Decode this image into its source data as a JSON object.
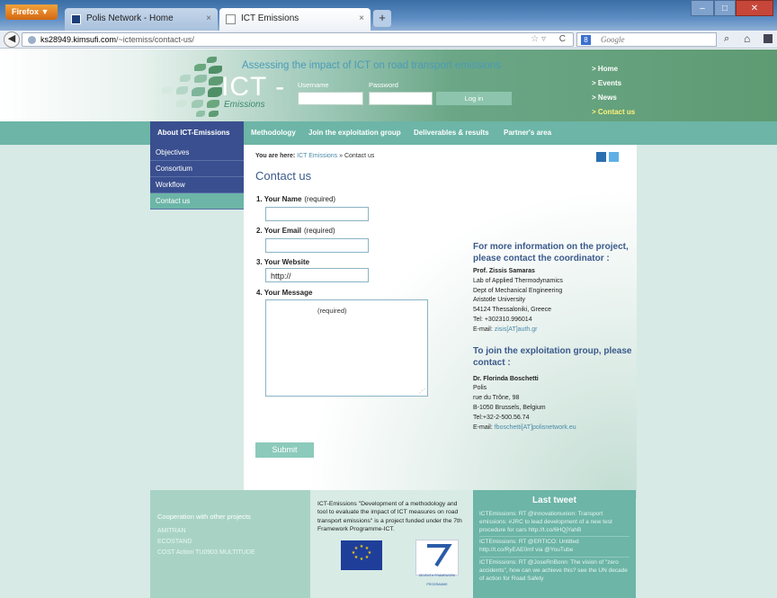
{
  "browser": {
    "menu_button": "Firefox ▼",
    "tabs": [
      {
        "title": "Polis Network - Home"
      },
      {
        "title": "ICT Emissions"
      }
    ],
    "new_tab": "+",
    "url_host": "ks28949.kimsufi.com",
    "url_path": "/~ictemiss/contact-us/",
    "search_placeholder": "Google",
    "search_engine_letter": "8"
  },
  "header": {
    "tagline": "Assessing the impact of ICT on road transport emissions",
    "logo_text": "ICT -",
    "logo_sub": "Emissions",
    "username_label": "Username",
    "password_label": "Password",
    "login_button": "Log in",
    "toplinks": [
      {
        "label": "> Home"
      },
      {
        "label": "> Events"
      },
      {
        "label": "> News"
      },
      {
        "label": "> Contact us"
      }
    ]
  },
  "nav": {
    "items": [
      {
        "label": "About ICT-Emissions"
      },
      {
        "label": "Methodology"
      },
      {
        "label": "Join the exploitation group"
      },
      {
        "label": "Deliverables & results"
      },
      {
        "label": "Partner's area"
      }
    ]
  },
  "sidebar": {
    "items": [
      {
        "label": "Objectives"
      },
      {
        "label": "Consortium"
      },
      {
        "label": "Workflow"
      },
      {
        "label": "Contact us"
      }
    ]
  },
  "main": {
    "breadcrumb_prefix": "You are here:",
    "breadcrumb_link": "ICT Emissions",
    "breadcrumb_current": "» Contact us",
    "title": "Contact us",
    "form": {
      "name_label": "1.  Your Name",
      "email_label": "2.  Your Email",
      "website_label": "3.  Your Website",
      "message_label": "4.  Your Message",
      "required": "(required)",
      "website_value": "http://",
      "message_placeholder": "(required)",
      "submit": "Submit"
    },
    "info": {
      "heading1": "For more information on the project, please contact the coordinator :",
      "coord_name": "Prof. Zissis Samaras",
      "coord_lines": [
        "Lab of Applied Thermodynamics",
        "Dept of Mechanical Engineering",
        "Aristotle University",
        "54124 Thessaloniki, Greece",
        "Tel: +302310.996014"
      ],
      "coord_email_prefix": "E-mail:",
      "coord_email": "zisis[AT]auth.gr",
      "heading2": "To join the exploitation group, please contact :",
      "join_name": "Dr. Florinda Boschetti",
      "join_lines": [
        "Polis",
        "rue du Trône, 98",
        "B-1050 Brussels, Belgium",
        "Tel:+32-2-500.56.74"
      ],
      "join_email_prefix": "E-mail:",
      "join_email": "fboschetti[AT]polisnetwork.eu"
    }
  },
  "footer": {
    "coop_heading": "Cooperation with other projects",
    "coop_links": [
      "AMITRAN",
      "ECOSTAND",
      "COST Action TU0903 MULTITUDE"
    ],
    "about_text": "ICT-Emissions \"Development of a methodology and tool to evaluate the impact of ICT measures on road transport emissions\" is a project funded under the 7th Framework Programme-ICT.",
    "fp7_caption": "SEVENTH FRAMEWORK PROGRAMME",
    "last_tweet_heading": "Last tweet",
    "tweets": [
      "ICTEmissions: RT @innovationunion: Transport emissions: #JRC to lead development of a new test procedure for cars http://t.co/6HQjYahB",
      "ICTEmissions: RT @ERTICO: Untitled http://t.co/RyEAE0mf via @YouTube",
      "ICTEmissions: RT @JoseRnBonn: The vision of \"zero accidents\", how can we achieve this? see the UN decade of action for Road Safety"
    ]
  },
  "colors": {
    "nav_bg": "#6cb5a7",
    "sidebar_bg": "#3a4f8f",
    "title_blue": "#3b5a8c",
    "link_blue": "#4a8aa8"
  }
}
